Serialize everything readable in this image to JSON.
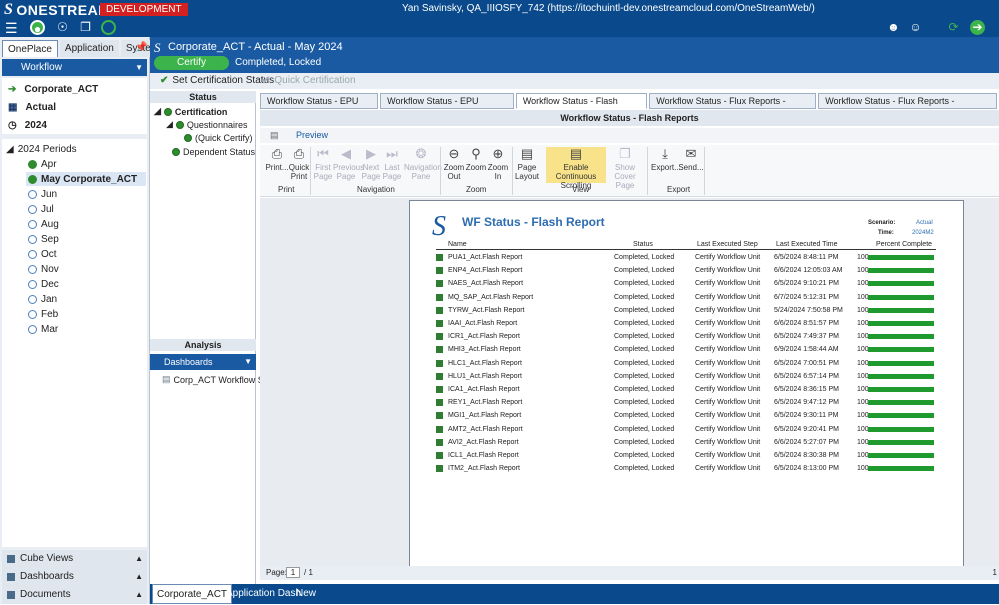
{
  "app": {
    "brand": "ONESTREAM",
    "env_badge": "DEVELOPMENT",
    "user_line": "Yan Savinsky, QA_IIIOSFY_742 (https://itochuintl-dev.onestreamcloud.com/OneStreamWeb/)"
  },
  "left": {
    "tabs": [
      "OnePlace",
      "Application",
      "System"
    ],
    "workflow_label": "Workflow",
    "pov": {
      "entity": "Corporate_ACT",
      "scenario": "Actual",
      "year": "2024"
    },
    "periods_root": "2024 Periods",
    "periods": [
      {
        "label": "Apr",
        "state": "done"
      },
      {
        "label": "May Corporate_ACT",
        "state": "selected"
      },
      {
        "label": "Jun",
        "state": "open"
      },
      {
        "label": "Jul",
        "state": "open"
      },
      {
        "label": "Aug",
        "state": "open"
      },
      {
        "label": "Sep",
        "state": "open"
      },
      {
        "label": "Oct",
        "state": "open"
      },
      {
        "label": "Nov",
        "state": "open"
      },
      {
        "label": "Dec",
        "state": "open"
      },
      {
        "label": "Jan",
        "state": "open"
      },
      {
        "label": "Feb",
        "state": "open"
      },
      {
        "label": "Mar",
        "state": "open"
      }
    ],
    "accordions": [
      "Cube Views",
      "Dashboards",
      "Documents"
    ]
  },
  "header": {
    "title": "Corporate_ACT - Actual - May 2024",
    "step": "Certify",
    "status": "Completed, Locked"
  },
  "certbar": {
    "set_status": "Set Certification Status",
    "quick": "Quick Certification"
  },
  "status_pane": {
    "heading": "Status",
    "items": [
      "Certification",
      "Questionnaires",
      "(Quick Certify)",
      "Dependent Status"
    ],
    "analysis_heading": "Analysis",
    "dashboards_label": "Dashboards",
    "dashboard_item": "Corp_ACT Workflow Status"
  },
  "tabs": [
    "Workflow Status - EPU IFRS",
    "Workflow Status - EPU USGAAP",
    "Workflow Status - Flash Reports",
    "Workflow Status - Flux Reports - Divisions",
    "Workflow Status - Flux Reports - Subsidiaries"
  ],
  "report_title": "Workflow Status - Flash Reports",
  "preview_label": "Preview",
  "ribbon": {
    "print": [
      "Print...",
      "Quick Print"
    ],
    "navigation": [
      "First Page",
      "Previous Page",
      "Next Page",
      "Last Page",
      "Navigation Pane"
    ],
    "zoom": [
      "Zoom Out",
      "Zoom",
      "Zoom In"
    ],
    "view": [
      "Page Layout",
      "Enable Continuous Scrolling",
      "Show Cover Page"
    ],
    "export": [
      "Export...",
      "Send..."
    ],
    "groups": [
      "Print",
      "Navigation",
      "Zoom",
      "View",
      "Export"
    ]
  },
  "report": {
    "title": "WF Status - Flash Report",
    "scenario_label": "Scenario:",
    "scenario_value": "Actual",
    "time_label": "Time:",
    "time_value": "2024M2",
    "columns": [
      "Name",
      "Status",
      "Last Executed Step",
      "Last Executed Time",
      "Percent Complete"
    ],
    "rows": [
      {
        "name": "PUA1_Act.Flash Report",
        "status": "Completed, Locked",
        "step": "Certify Workflow Unit",
        "time": "6/5/2024 8:48:11 PM",
        "pct": 100
      },
      {
        "name": "ENP4_Act.Flash Report",
        "status": "Completed, Locked",
        "step": "Certify Workflow Unit",
        "time": "6/6/2024 12:05:03 AM",
        "pct": 100
      },
      {
        "name": "NAES_Act.Flash Report",
        "status": "Completed, Locked",
        "step": "Certify Workflow Unit",
        "time": "6/5/2024 9:10:21 PM",
        "pct": 100
      },
      {
        "name": "MQ_SAP_Act.Flash Report",
        "status": "Completed, Locked",
        "step": "Certify Workflow Unit",
        "time": "6/7/2024 5:12:31 PM",
        "pct": 100
      },
      {
        "name": "TYRW_Act.Flash Report",
        "status": "Completed, Locked",
        "step": "Certify Workflow Unit",
        "time": "5/24/2024 7:50:58 PM",
        "pct": 100
      },
      {
        "name": "IAAI_Act.Flash Report",
        "status": "Completed, Locked",
        "step": "Certify Workflow Unit",
        "time": "6/6/2024 8:51:57 PM",
        "pct": 100
      },
      {
        "name": "ICR1_Act.Flash Report",
        "status": "Completed, Locked",
        "step": "Certify Workflow Unit",
        "time": "6/5/2024 7:49:37 PM",
        "pct": 100
      },
      {
        "name": "MHI3_Act.Flash Report",
        "status": "Completed, Locked",
        "step": "Certify Workflow Unit",
        "time": "6/9/2024 1:58:44 AM",
        "pct": 100
      },
      {
        "name": "HLC1_Act.Flash Report",
        "status": "Completed, Locked",
        "step": "Certify Workflow Unit",
        "time": "6/5/2024 7:00:51 PM",
        "pct": 100
      },
      {
        "name": "HLU1_Act.Flash Report",
        "status": "Completed, Locked",
        "step": "Certify Workflow Unit",
        "time": "6/5/2024 6:57:14 PM",
        "pct": 100
      },
      {
        "name": "ICA1_Act.Flash Report",
        "status": "Completed, Locked",
        "step": "Certify Workflow Unit",
        "time": "6/5/2024 8:36:15 PM",
        "pct": 100
      },
      {
        "name": "REY1_Act.Flash Report",
        "status": "Completed, Locked",
        "step": "Certify Workflow Unit",
        "time": "6/5/2024 9:47:12 PM",
        "pct": 100
      },
      {
        "name": "MGI1_Act.Flash Report",
        "status": "Completed, Locked",
        "step": "Certify Workflow Unit",
        "time": "6/5/2024 9:30:11 PM",
        "pct": 100
      },
      {
        "name": "AMT2_Act.Flash Report",
        "status": "Completed, Locked",
        "step": "Certify Workflow Unit",
        "time": "6/5/2024 9:20:41 PM",
        "pct": 100
      },
      {
        "name": "AVI2_Act.Flash Report",
        "status": "Completed, Locked",
        "step": "Certify Workflow Unit",
        "time": "6/6/2024 5:27:07 PM",
        "pct": 100
      },
      {
        "name": "ICL1_Act.Flash Report",
        "status": "Completed, Locked",
        "step": "Certify Workflow Unit",
        "time": "6/5/2024 8:30:38 PM",
        "pct": 100
      },
      {
        "name": "ITM2_Act.Flash Report",
        "status": "Completed, Locked",
        "step": "Certify Workflow Unit",
        "time": "6/5/2024 8:13:00 PM",
        "pct": 100
      }
    ]
  },
  "pager": {
    "label": "Page:",
    "current": "1",
    "of": "/ 1",
    "right": "1"
  },
  "footer_tabs": [
    "Corporate_ACT",
    "Application Dash",
    "New"
  ],
  "colors": {
    "brand_blue": "#0a4a8c",
    "accent_blue": "#1a5aa2",
    "ok_green": "#3cb44b",
    "dev_red": "#d32020",
    "highlight": "#f8e38a"
  }
}
